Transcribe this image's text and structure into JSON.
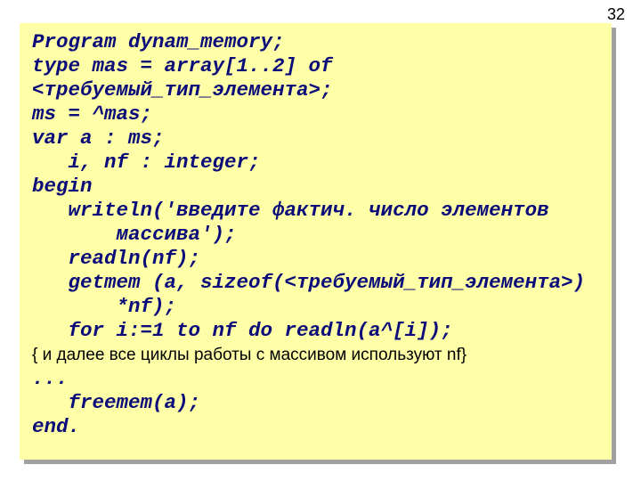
{
  "page_number": "32",
  "code": {
    "l1": "Program dynam_memory;",
    "l2": "type mas = array[1..2] of",
    "l3": "<требуемый_тип_элемента>;",
    "l4": "ms = ^mas;",
    "l5": "var a : ms;",
    "l6": "   i, nf : integer;",
    "l7": "begin",
    "l8": "   writeln('введите фактич. число элементов",
    "l9": "       массива');",
    "l10": "   readln(nf);",
    "l11": "   getmem (a, sizeof(<требуемый_тип_элемента>)",
    "l12": "       *nf);",
    "l13": "   for i:=1 to nf do readln(a^[i]);",
    "l14": "{ и далее все циклы работы с массивом используют nf}",
    "l15": "...",
    "l16": "   freemem(a);",
    "l17": "end."
  }
}
